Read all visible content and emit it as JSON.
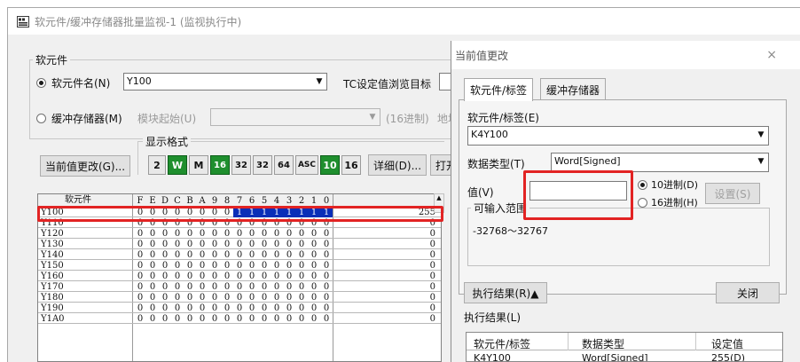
{
  "main": {
    "title": "软元件/缓冲存储器批量监视-1 (监视执行中)",
    "device_group_label": "软元件",
    "device_name_label": "软元件名(N)",
    "device_name_value": "Y100",
    "tc_label": "TC设定值浏览目标",
    "buffer_label": "缓冲存储器(M)",
    "module_start_label": "模块起始(U)",
    "hex_label": "(16进制)",
    "address_label": "地址",
    "current_change_button": "当前值更改(G)...",
    "display_format_label": "显示格式",
    "detail_button": "详细(D)...",
    "open_button": "打开",
    "format_buttons": [
      "2",
      "W",
      "M",
      "16",
      "32",
      "32",
      "64",
      "ASC",
      "10",
      "16"
    ],
    "table": {
      "header_device": "软元件",
      "bit_headers": [
        "F",
        "E",
        "D",
        "C",
        "B",
        "A",
        "9",
        "8",
        "7",
        "6",
        "5",
        "4",
        "3",
        "2",
        "1",
        "0"
      ],
      "rows": [
        {
          "name": "Y100",
          "bits": [
            "0",
            "0",
            "0",
            "0",
            "0",
            "0",
            "0",
            "0",
            "1",
            "1",
            "1",
            "1",
            "1",
            "1",
            "1",
            "1"
          ],
          "value": "255"
        },
        {
          "name": "Y110",
          "bits": [
            "0",
            "0",
            "0",
            "0",
            "0",
            "0",
            "0",
            "0",
            "0",
            "0",
            "0",
            "0",
            "0",
            "0",
            "0",
            "0"
          ],
          "value": "0"
        },
        {
          "name": "Y120",
          "bits": [
            "0",
            "0",
            "0",
            "0",
            "0",
            "0",
            "0",
            "0",
            "0",
            "0",
            "0",
            "0",
            "0",
            "0",
            "0",
            "0"
          ],
          "value": "0"
        },
        {
          "name": "Y130",
          "bits": [
            "0",
            "0",
            "0",
            "0",
            "0",
            "0",
            "0",
            "0",
            "0",
            "0",
            "0",
            "0",
            "0",
            "0",
            "0",
            "0"
          ],
          "value": "0"
        },
        {
          "name": "Y140",
          "bits": [
            "0",
            "0",
            "0",
            "0",
            "0",
            "0",
            "0",
            "0",
            "0",
            "0",
            "0",
            "0",
            "0",
            "0",
            "0",
            "0"
          ],
          "value": "0"
        },
        {
          "name": "Y150",
          "bits": [
            "0",
            "0",
            "0",
            "0",
            "0",
            "0",
            "0",
            "0",
            "0",
            "0",
            "0",
            "0",
            "0",
            "0",
            "0",
            "0"
          ],
          "value": "0"
        },
        {
          "name": "Y160",
          "bits": [
            "0",
            "0",
            "0",
            "0",
            "0",
            "0",
            "0",
            "0",
            "0",
            "0",
            "0",
            "0",
            "0",
            "0",
            "0",
            "0"
          ],
          "value": "0"
        },
        {
          "name": "Y170",
          "bits": [
            "0",
            "0",
            "0",
            "0",
            "0",
            "0",
            "0",
            "0",
            "0",
            "0",
            "0",
            "0",
            "0",
            "0",
            "0",
            "0"
          ],
          "value": "0"
        },
        {
          "name": "Y180",
          "bits": [
            "0",
            "0",
            "0",
            "0",
            "0",
            "0",
            "0",
            "0",
            "0",
            "0",
            "0",
            "0",
            "0",
            "0",
            "0",
            "0"
          ],
          "value": "0"
        },
        {
          "name": "Y190",
          "bits": [
            "0",
            "0",
            "0",
            "0",
            "0",
            "0",
            "0",
            "0",
            "0",
            "0",
            "0",
            "0",
            "0",
            "0",
            "0",
            "0"
          ],
          "value": "0"
        },
        {
          "name": "Y1A0",
          "bits": [
            "0",
            "0",
            "0",
            "0",
            "0",
            "0",
            "0",
            "0",
            "0",
            "0",
            "0",
            "0",
            "0",
            "0",
            "0",
            "0"
          ],
          "value": "0"
        }
      ]
    }
  },
  "dialog": {
    "title": "当前值更改",
    "close_glyph": "×",
    "tab_device": "软元件/标签",
    "tab_buffer": "缓冲存储器",
    "device_label": "软元件/标签(E)",
    "device_value": "K4Y100",
    "data_type_label": "数据类型(T)",
    "data_type_value": "Word[Signed]",
    "value_label": "值(V)",
    "value_input": "",
    "radio_dec": "10进制(D)",
    "radio_hex": "16进制(H)",
    "set_button": "设置(S)",
    "range_label": "可输入范围",
    "range_value": "-32768～32767",
    "exec_result_button": "执行结果(R)▲",
    "close_button": "关闭",
    "exec_result_label": "执行结果(L)",
    "result_table": {
      "headers": [
        "软元件/标签",
        "数据类型",
        "设定值"
      ],
      "row": [
        "K4Y100",
        "Word[Signed]",
        "255(D)"
      ]
    }
  },
  "colors": {
    "highlight_red": "#e22323",
    "selection_blue": "#0a2eb8",
    "format_green": "#1f8f2e"
  }
}
